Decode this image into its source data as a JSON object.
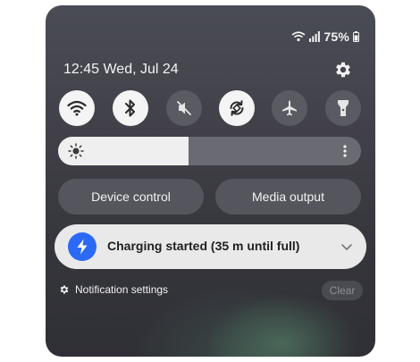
{
  "status_bar": {
    "battery_text": "75%",
    "icons": [
      "wifi-icon",
      "signal-icon",
      "battery-icon"
    ]
  },
  "header": {
    "clock": "12:45 Wed, Jul 24",
    "settings_icon": "gear-icon"
  },
  "quick_settings": [
    {
      "name": "wifi",
      "icon": "wifi-icon",
      "state": "on"
    },
    {
      "name": "bluetooth",
      "icon": "bluetooth-icon",
      "state": "on"
    },
    {
      "name": "sound",
      "icon": "mute-icon",
      "state": "off"
    },
    {
      "name": "auto-rotate",
      "icon": "rotate-icon",
      "state": "on"
    },
    {
      "name": "airplane-mode",
      "icon": "airplane-icon",
      "state": "off"
    },
    {
      "name": "flashlight",
      "icon": "flashlight-icon",
      "state": "off"
    }
  ],
  "brightness": {
    "level_fraction": 0.43,
    "icon": "sun-icon",
    "more_icon": "more-vertical-icon"
  },
  "buttons": {
    "device_control": "Device control",
    "media_output": "Media output"
  },
  "notification": {
    "title": "Charging started (35 m until full)",
    "icon": "bolt-icon",
    "accent": "#2b6af6"
  },
  "footer": {
    "notification_settings": "Notification settings",
    "clear": "Clear"
  }
}
